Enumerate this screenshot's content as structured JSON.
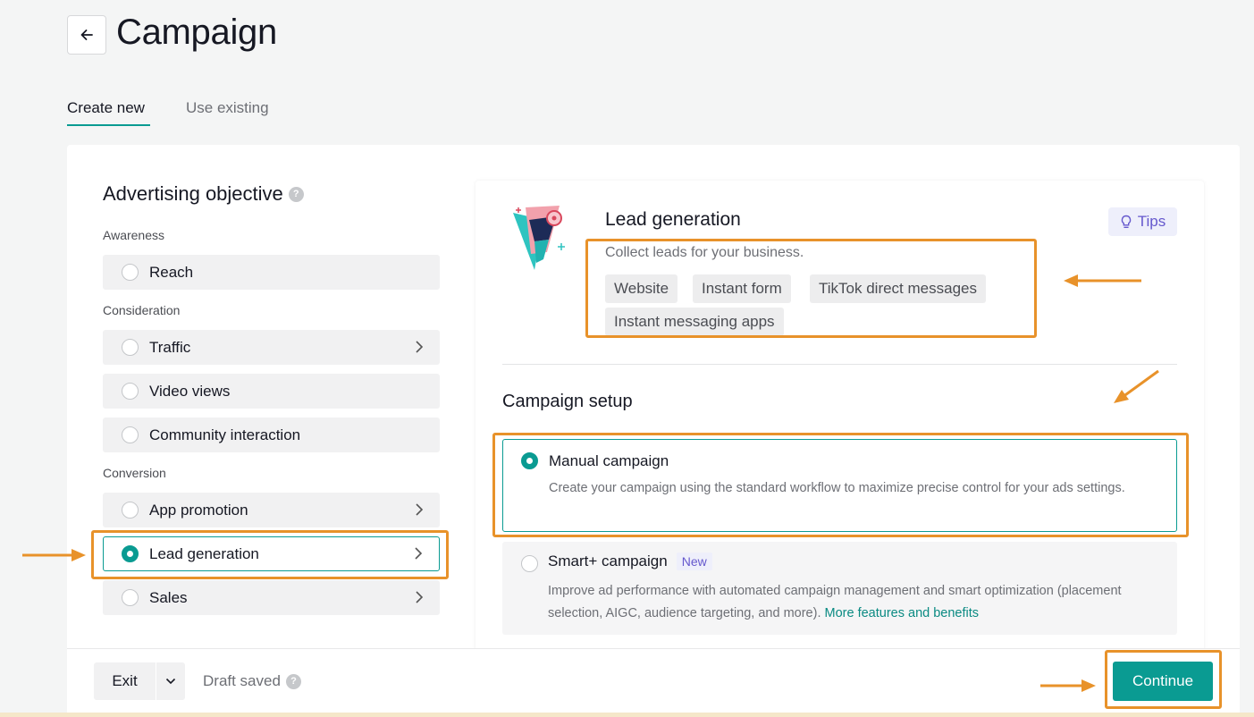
{
  "header": {
    "title": "Campaign",
    "back_icon": "arrow-left-icon"
  },
  "tabs": [
    {
      "label": "Create new",
      "active": true
    },
    {
      "label": "Use existing",
      "active": false
    }
  ],
  "objective": {
    "title": "Advertising objective",
    "help_icon": "question-icon",
    "groups": [
      {
        "label": "Awareness",
        "items": [
          {
            "label": "Reach",
            "has_chevron": false
          }
        ]
      },
      {
        "label": "Consideration",
        "items": [
          {
            "label": "Traffic",
            "has_chevron": true
          },
          {
            "label": "Video views",
            "has_chevron": false
          },
          {
            "label": "Community interaction",
            "has_chevron": false
          }
        ]
      },
      {
        "label": "Conversion",
        "items": [
          {
            "label": "App promotion",
            "has_chevron": true
          },
          {
            "label": "Lead generation",
            "has_chevron": true,
            "selected": true
          },
          {
            "label": "Sales",
            "has_chevron": true
          }
        ]
      }
    ]
  },
  "detail": {
    "title": "Lead generation",
    "description": "Collect leads for your business.",
    "tags": [
      "Website",
      "Instant form",
      "TikTok direct messages",
      "Instant messaging apps"
    ],
    "tips_label": "Tips",
    "tips_icon": "lightbulb-icon"
  },
  "setup": {
    "title": "Campaign setup",
    "options": [
      {
        "title": "Manual campaign",
        "description": "Create your campaign using the standard workflow to maximize precise control for your ads settings.",
        "selected": true
      },
      {
        "title": "Smart+ campaign",
        "badge": "New",
        "description": "Improve ad performance with automated campaign management and smart optimization (placement selection, AIGC, audience targeting, and more).",
        "link": "More features and benefits",
        "selected": false
      }
    ]
  },
  "footer": {
    "exit_label": "Exit",
    "draft_label": "Draft saved",
    "continue_label": "Continue"
  },
  "colors": {
    "accent": "#0a9b92",
    "annotation": "#e8922a",
    "tips": "#6558cd"
  }
}
